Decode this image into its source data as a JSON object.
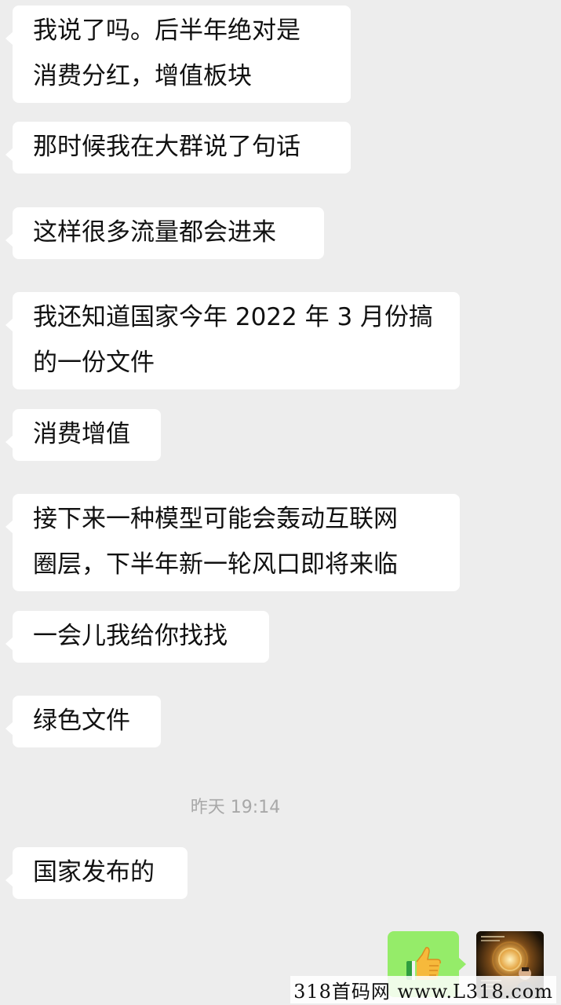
{
  "messages": [
    {
      "lines": [
        "我说了吗。后半年绝对是",
        "消费分红，增值板块"
      ]
    },
    {
      "lines": [
        "那时候我在大群说了句话"
      ]
    },
    {
      "lines": [
        "这样很多流量都会进来"
      ]
    },
    {
      "lines": [
        "我还知道国家今年 2022 年 3 月份搞",
        "的一份文件"
      ]
    },
    {
      "lines": [
        "消费增值"
      ]
    },
    {
      "lines": [
        "接下来一种模型可能会轰动互联网",
        "圈层，下半年新一轮风口即将来临"
      ]
    },
    {
      "lines": [
        "一会儿我给你找找"
      ]
    },
    {
      "lines": [
        "绿色文件"
      ]
    },
    {
      "lines": [
        "国家发布的"
      ]
    }
  ],
  "timestamp": "昨天 19:14",
  "sent_message": {
    "icon": "thumbs-up-icon"
  },
  "avatar": {
    "icon": "avatar-image"
  },
  "watermark": "318首码网 www.L318.com",
  "colors": {
    "background": "#ededed",
    "received_bubble": "#ffffff",
    "sent_bubble": "#95ec69",
    "timestamp_text": "#a8a8a8"
  }
}
